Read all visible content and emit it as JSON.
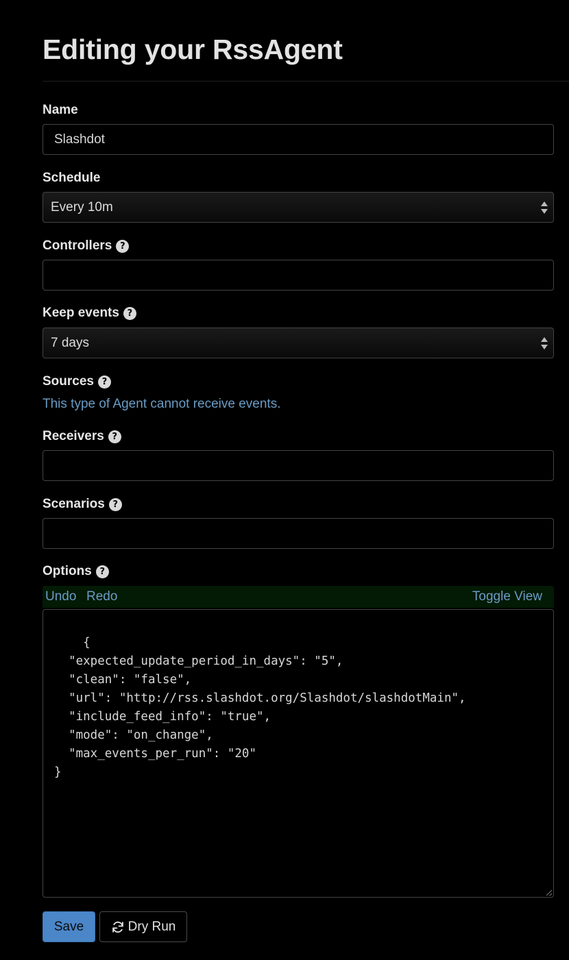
{
  "page": {
    "title": "Editing your RssAgent"
  },
  "form": {
    "name": {
      "label": "Name",
      "value": "Slashdot"
    },
    "schedule": {
      "label": "Schedule",
      "selected": "Every 10m"
    },
    "controllers": {
      "label": "Controllers",
      "help_icon": "question-circle-icon",
      "value": ""
    },
    "keep_events": {
      "label": "Keep events",
      "help_icon": "question-circle-icon",
      "selected": "7 days"
    },
    "sources": {
      "label": "Sources",
      "help_icon": "question-circle-icon",
      "message": "This type of Agent cannot receive events."
    },
    "receivers": {
      "label": "Receivers",
      "help_icon": "question-circle-icon",
      "value": ""
    },
    "scenarios": {
      "label": "Scenarios",
      "help_icon": "question-circle-icon",
      "value": ""
    },
    "options": {
      "label": "Options",
      "help_icon": "question-circle-icon",
      "toolbar": {
        "undo": "Undo",
        "redo": "Redo",
        "toggle_view": "Toggle View"
      },
      "json_text": "{\n  \"expected_update_period_in_days\": \"5\",\n  \"clean\": \"false\",\n  \"url\": \"http://rss.slashdot.org/Slashdot/slashdotMain\",\n  \"include_feed_info\": \"true\",\n  \"mode\": \"on_change\",\n  \"max_events_per_run\": \"20\"\n}"
    }
  },
  "actions": {
    "save_label": "Save",
    "dry_run_label": "Dry Run",
    "dry_run_icon": "refresh-icon"
  },
  "colors": {
    "background": "#000000",
    "link": "#6a9cc5",
    "primary_button": "#4a86c8",
    "toolbar_bg": "#031a04"
  }
}
